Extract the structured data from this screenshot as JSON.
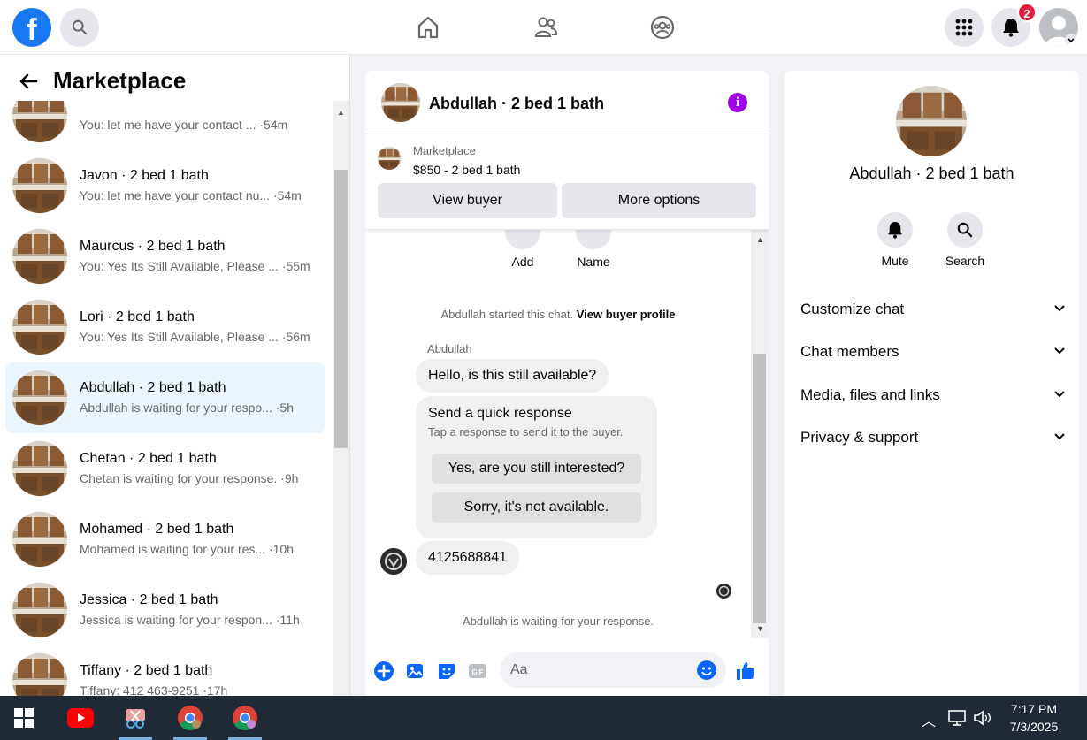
{
  "topbar": {
    "logo": "f",
    "notifications_count": "2",
    "icons": [
      "search-icon",
      "home-icon",
      "friends-icon",
      "groups-icon",
      "menu-grid-icon",
      "bell-icon",
      "account-avatar"
    ]
  },
  "sidebar": {
    "title": "Marketplace",
    "conversations": [
      {
        "name": "",
        "snippet": "You: let me have your contact ... ·54m"
      },
      {
        "name": "Javon · 2 bed 1 bath",
        "snippet": "You: let me have your contact nu... ·54m"
      },
      {
        "name": "Maurcus · 2 bed 1 bath",
        "snippet": "You: Yes Its Still Available, Please ... ·55m"
      },
      {
        "name": "Lori · 2 bed 1 bath",
        "snippet": "You: Yes Its Still Available, Please ... ·56m"
      },
      {
        "name": "Abdullah · 2 bed 1 bath",
        "snippet": "Abdullah is waiting for your respo... ·5h",
        "active": true
      },
      {
        "name": "Chetan · 2 bed 1 bath",
        "snippet": "Chetan is waiting for your response. ·9h"
      },
      {
        "name": "Mohamed · 2 bed 1 bath",
        "snippet": "Mohamed is waiting for your res... ·10h"
      },
      {
        "name": "Jessica · 2 bed 1 bath",
        "snippet": "Jessica is waiting for your respon... ·11h"
      },
      {
        "name": "Tiffany · 2 bed 1 bath",
        "snippet": "Tiffany: 412 463-9251 ·17h"
      }
    ]
  },
  "chat": {
    "title": "Abdullah · 2 bed 1 bath",
    "listing": {
      "label": "Marketplace",
      "price": "$850 - 2 bed 1 bath"
    },
    "buttons": {
      "view_buyer": "View buyer",
      "more_options": "More options"
    },
    "actions": {
      "add": "Add",
      "name": "Name"
    },
    "started_text": "Abdullah started this chat.",
    "started_link": "View buyer profile",
    "sender": "Abdullah",
    "first_message": "Hello, is this still available?",
    "quick": {
      "title": "Send a quick response",
      "subtitle": "Tap a response to send it to the buyer.",
      "option1": "Yes, are you still interested?",
      "option2": "Sorry, it's not available."
    },
    "phone_message": "4125688841",
    "waiting_text": "Abdullah is waiting for your response.",
    "composer_placeholder": "Aa"
  },
  "details": {
    "name": "Abdullah · 2 bed 1 bath",
    "mute": "Mute",
    "search": "Search",
    "sections": [
      "Customize chat",
      "Chat members",
      "Media, files and links",
      "Privacy & support"
    ]
  },
  "taskbar": {
    "time": "7:17 PM",
    "date": "7/3/2025"
  },
  "colors": {
    "brand": "#1877f2",
    "badge": "#e41e3f",
    "info": "#a000e6",
    "active_row": "#ebf5ff"
  }
}
